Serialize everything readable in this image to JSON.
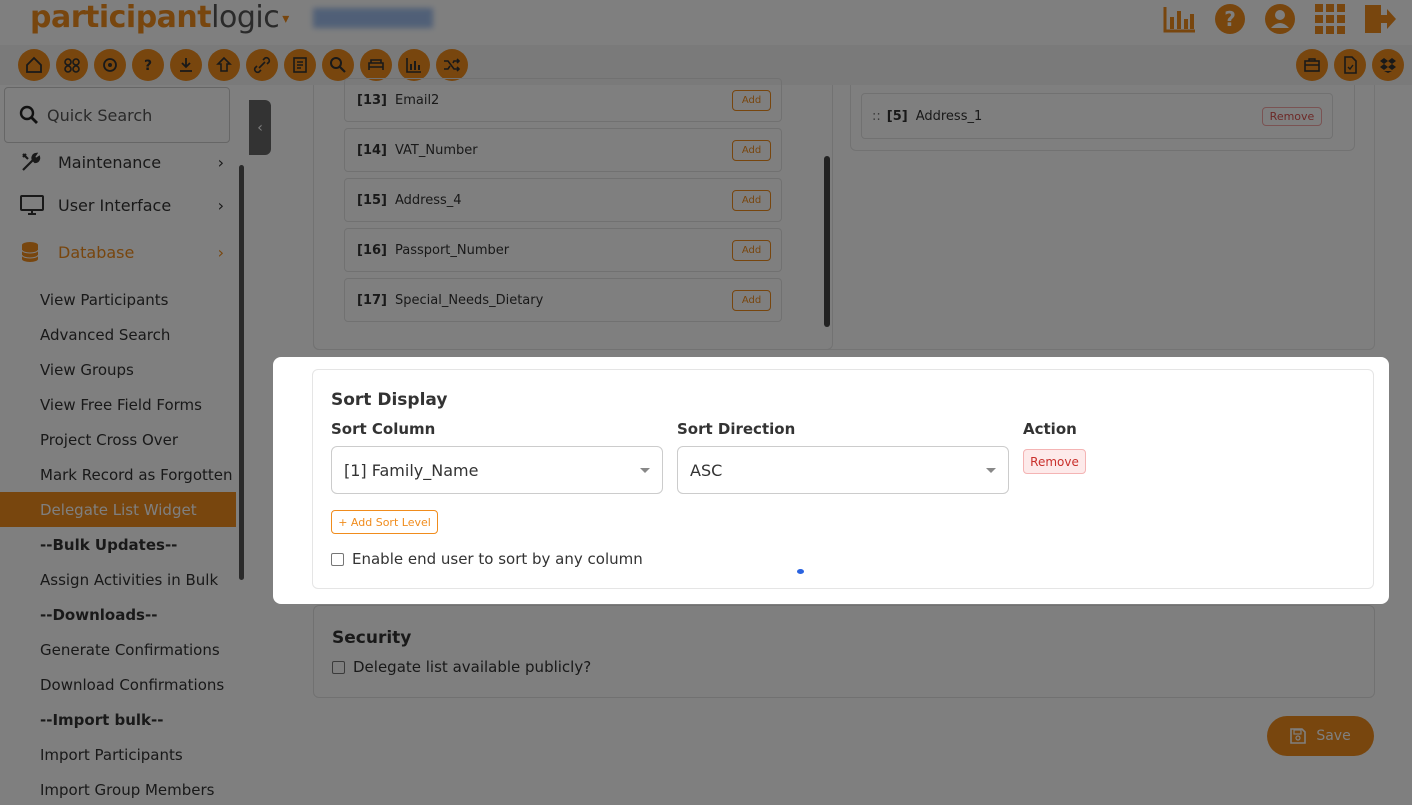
{
  "header": {
    "logo_bold": "participant",
    "logo_light": "logic",
    "logo_caret": "▾",
    "icons": [
      "bar-chart-icon",
      "help-icon",
      "user-icon",
      "apps-grid-icon",
      "logout-icon"
    ]
  },
  "toolbar": {
    "left_icons": [
      "home-icon",
      "groups-icon",
      "settings-icon",
      "question-icon",
      "download-icon",
      "upload-icon",
      "link-icon",
      "form-icon",
      "search-icon",
      "hotel-icon",
      "report-icon",
      "shuffle-icon"
    ],
    "right_icons": [
      "briefcase-icon",
      "document-icon",
      "dropbox-icon"
    ]
  },
  "sidebar": {
    "search_label": "Quick Search",
    "nav": [
      {
        "label": "Maintenance",
        "icon": "tools-icon"
      },
      {
        "label": "User Interface",
        "icon": "monitor-icon"
      },
      {
        "label": "Database",
        "icon": "database-icon"
      }
    ],
    "sub_items": [
      "View Participants",
      "Advanced Search",
      "View Groups",
      "View Free Field Forms",
      "Project Cross Over",
      "Mark Record as Forgotten",
      "Delegate List Widget",
      "--Bulk Updates--",
      "Assign Activities in Bulk",
      "--Downloads--",
      "Generate Confirmations",
      "Download Confirmations",
      "--Import bulk--",
      "Import Participants",
      "Import Group Members"
    ],
    "active_item": "Delegate List Widget"
  },
  "available_fields": [
    {
      "index": "[13]",
      "name": "Email2",
      "action": "Add"
    },
    {
      "index": "[14]",
      "name": "VAT_Number",
      "action": "Add"
    },
    {
      "index": "[15]",
      "name": "Address_4",
      "action": "Add"
    },
    {
      "index": "[16]",
      "name": "Passport_Number",
      "action": "Add"
    },
    {
      "index": "[17]",
      "name": "Special_Needs_Dietary",
      "action": "Add"
    }
  ],
  "selected_fields": [
    {
      "drag": "::",
      "index": "[5]",
      "name": "Address_1",
      "action": "Remove"
    }
  ],
  "security": {
    "title": "Security",
    "public_label": "Delegate list available publicly?"
  },
  "save_label": "Save",
  "modal": {
    "title": "Sort Display",
    "col_sort_column": "Sort Column",
    "col_sort_direction": "Sort Direction",
    "col_action": "Action",
    "sort_column_value": "[1] Family_Name",
    "sort_direction_value": "ASC",
    "remove_label": "Remove",
    "add_sort_level": "+ Add Sort Level",
    "enable_label": "Enable end user to sort by any column"
  },
  "colors": {
    "accent": "#f08c1d",
    "danger": "#d9534f",
    "spinner": "#2a63e0"
  }
}
